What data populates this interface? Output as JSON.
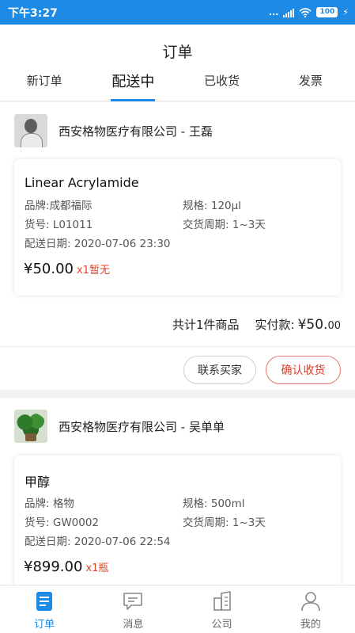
{
  "status_bar": {
    "time": "下午3:27",
    "dots": "...",
    "battery": "100"
  },
  "header": {
    "title": "订单",
    "tabs": [
      {
        "label": "新订单"
      },
      {
        "label": "配送中"
      },
      {
        "label": "已收货"
      },
      {
        "label": "发票"
      }
    ],
    "active_tab": "配送中"
  },
  "orders": [
    {
      "shop": "西安格物医疗有限公司 - 王磊",
      "item": {
        "name": "Linear Acrylamide",
        "brand_label": "品牌:",
        "brand": "成都福际",
        "spec_label": "规格:",
        "spec": "120μl",
        "sku_label": "货号:",
        "sku": "L01011",
        "period_label": "交货周期:",
        "period": "1~3天",
        "date_label": "配送日期:",
        "date": "2020-07-06 23:30",
        "price": "¥50.00",
        "qty": "x1暂无"
      },
      "summary_count": "共计1件商品",
      "summary_paid_label": "实付款:",
      "summary_paid_value": "¥50.",
      "summary_paid_decimal": "00",
      "buttons": {
        "contact": "联系买家",
        "confirm": "确认收货"
      }
    },
    {
      "shop": "西安格物医疗有限公司 - 吴单单",
      "item": {
        "name": "甲醇",
        "brand_label": "品牌:",
        "brand": "格物",
        "spec_label": "规格:",
        "spec": "500ml",
        "sku_label": "货号:",
        "sku": "GW0002",
        "period_label": "交货周期:",
        "period": "1~3天",
        "date_label": "配送日期:",
        "date": "2020-07-06 22:54",
        "price": "¥899.00",
        "qty": "x1瓶"
      }
    }
  ],
  "bottom_nav": [
    {
      "label": "订单",
      "icon": "order-icon",
      "active": true
    },
    {
      "label": "消息",
      "icon": "message-icon",
      "active": false
    },
    {
      "label": "公司",
      "icon": "company-icon",
      "active": false
    },
    {
      "label": "我的",
      "icon": "profile-icon",
      "active": false
    }
  ],
  "colors": {
    "accent": "#1d8ae6",
    "price_red": "#e0452a"
  }
}
